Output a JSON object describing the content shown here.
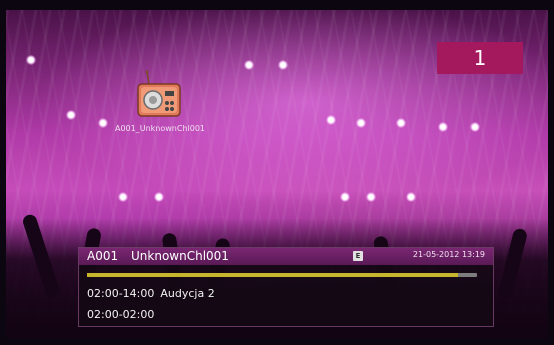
{
  "osd": {
    "channel_number_box": "1",
    "logo_caption": "A001_UnknownChl001",
    "radio_icon": "radio-icon"
  },
  "info_bar": {
    "channel_number": "A001",
    "channel_name": "UnknownChl001",
    "epg_badge": "E",
    "datetime": "21-05-2012 13:19",
    "progress": 0.95,
    "programs": [
      {
        "time": "02:00-14:00",
        "title": "Audycja 2"
      },
      {
        "time": "02:00-02:00",
        "title": ""
      }
    ]
  },
  "colors": {
    "channel_box": "#a4195e",
    "header": "#7a2672",
    "progress_fill": "#c7b62d",
    "progress_track": "#7d7d7d"
  }
}
